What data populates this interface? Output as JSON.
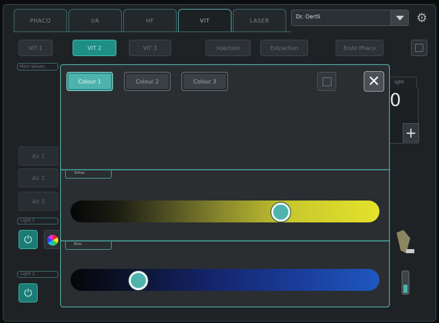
{
  "tabs": [
    "PHACO",
    "I/A",
    "HF",
    "VIT",
    "LASER"
  ],
  "active_tab": "VIT",
  "user": {
    "selected": "Dr. Oertli"
  },
  "sub_buttons": [
    {
      "label": "VIT 1",
      "active": false
    },
    {
      "label": "VIT 2",
      "active": true
    },
    {
      "label": "VIT 3",
      "active": false
    },
    {
      "label": "Injection",
      "active": false
    },
    {
      "label": "Extraction",
      "active": false
    },
    {
      "label": "Endo Phaco",
      "active": false
    }
  ],
  "sidebar": {
    "main_values": "Main Values",
    "air_buttons": [
      "Air 1",
      "Air 2",
      "Air 3"
    ],
    "light1": "Light 1",
    "light2": "Light 2"
  },
  "right_panel": {
    "label": "ight",
    "value": "0",
    "plus": "+"
  },
  "modal": {
    "colour_buttons": [
      {
        "label": "Colour 1",
        "active": true
      },
      {
        "label": "Colour 2",
        "active": false
      },
      {
        "label": "Colour 3",
        "active": false
      }
    ],
    "close": "✕",
    "yellow": {
      "label": "Yellow",
      "level": 0.68
    },
    "blue": {
      "label": "Blue",
      "level": 0.22
    }
  },
  "colors": {
    "accent": "#4fb3ad",
    "border": "#3e8a85"
  },
  "icons": {
    "gear": "gear-icon",
    "power": "power-icon",
    "save": "save-icon",
    "close": "close-icon"
  }
}
